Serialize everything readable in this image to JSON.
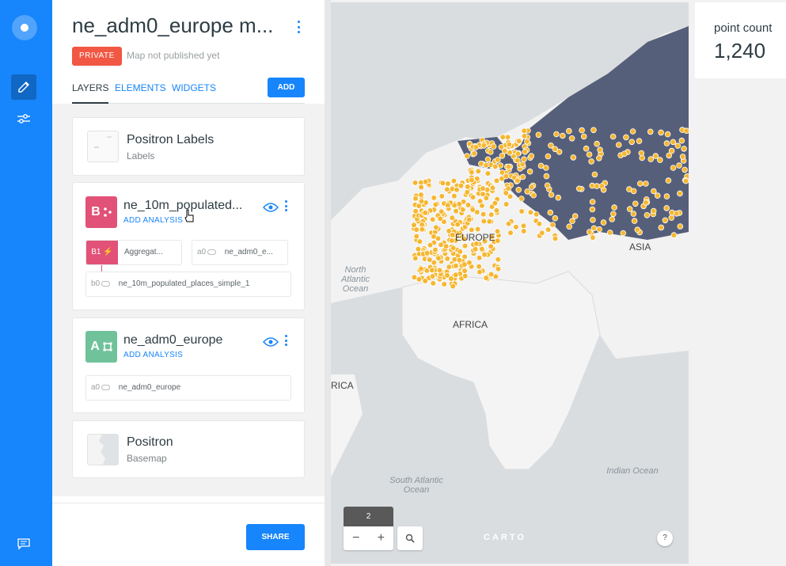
{
  "app": {
    "accent": "#1785fb"
  },
  "rail": {
    "items": [
      "logo",
      "edit-pencil",
      "settings-sliders",
      "chat"
    ]
  },
  "header": {
    "title": "ne_adm0_europe m...",
    "privacy_badge": "PRIVATE",
    "publish_status": "Map not published yet"
  },
  "tabs": [
    {
      "label": "LAYERS",
      "active": true
    },
    {
      "label": "ELEMENTS",
      "active": false
    },
    {
      "label": "WIDGETS",
      "active": false
    }
  ],
  "add_button": "ADD",
  "layers": {
    "labels": {
      "name": "Positron Labels",
      "type": "Labels"
    },
    "layer_b": {
      "letter": "B",
      "color": "#e25177",
      "name": "ne_10m_populated...",
      "add_analysis": "ADD ANALYSIS",
      "analysis_id": "B1",
      "analysis_name": "Aggregat...",
      "analysis_source_tag": "a0",
      "analysis_source": "ne_adm0_e...",
      "source_tag": "b0",
      "source": "ne_10m_populated_places_simple_1"
    },
    "layer_a": {
      "letter": "A",
      "color": "#70c29b",
      "name": "ne_adm0_europe",
      "add_analysis": "ADD ANALYSIS",
      "source_tag": "a0",
      "source": "ne_adm0_europe"
    },
    "basemap": {
      "name": "Positron",
      "type": "Basemap"
    }
  },
  "share_button": "SHARE",
  "map": {
    "labels": {
      "europe": "EUROPE",
      "asia": "ASIA",
      "africa": "AFRICA",
      "america": "RICA",
      "north_atlantic": "North Atlantic Ocean",
      "south_atlantic": "South Atlantic Ocean",
      "indian_ocean": "Indian Ocean"
    },
    "zoom_level": "2",
    "zoom_out": "−",
    "zoom_in": "+",
    "attribution": "CARTO",
    "help": "?"
  },
  "widget": {
    "title": "point count",
    "value": "1,240"
  }
}
